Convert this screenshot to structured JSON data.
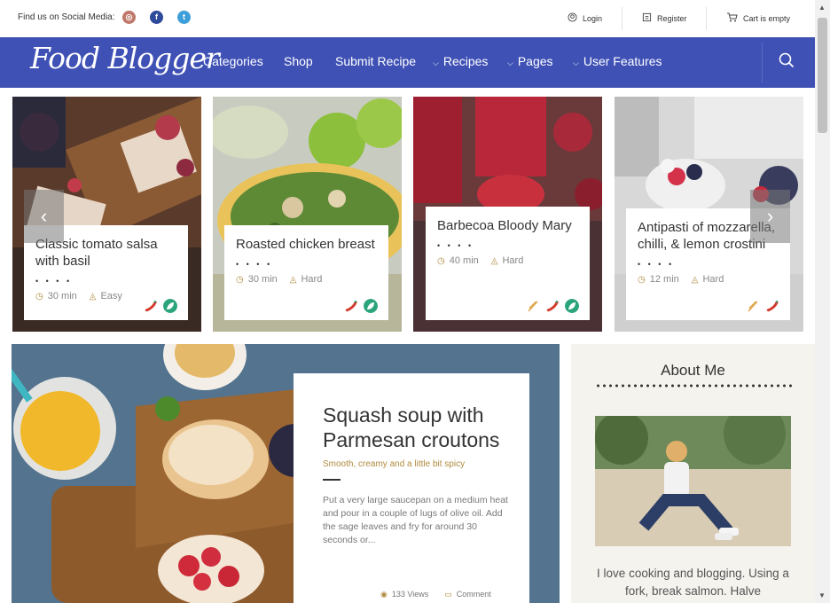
{
  "topbar": {
    "social_label": "Find us on Social Media:",
    "social_icons": [
      "instagram-icon",
      "facebook-icon",
      "twitter-icon"
    ],
    "login": "Login",
    "register": "Register",
    "cart": "Cart is empty"
  },
  "nav": {
    "logo": "Food Blogger",
    "items": [
      {
        "label": "Categories",
        "dropdown": false
      },
      {
        "label": "Shop",
        "dropdown": false
      },
      {
        "label": "Submit Recipe",
        "dropdown": false
      },
      {
        "label": "Recipes",
        "dropdown": true
      },
      {
        "label": "Pages",
        "dropdown": true
      },
      {
        "label": "User Features",
        "dropdown": true
      }
    ],
    "accent": "#3f51b5"
  },
  "slider": {
    "cards": [
      {
        "title": "Classic tomato salsa with basil",
        "dots": "• • • •",
        "time": "30 min",
        "difficulty": "Easy"
      },
      {
        "title": "Roasted chicken breast",
        "dots": "• • • •",
        "time": "30 min",
        "difficulty": "Hard"
      },
      {
        "title": "Barbecoa Bloody Mary",
        "dots": "• • • •",
        "time": "40 min",
        "difficulty": "Hard"
      },
      {
        "title": "Antipasti of mozzarella, chilli, & lemon crostini",
        "dots": "• • • •",
        "time": "12 min",
        "difficulty": "Hard"
      }
    ]
  },
  "featured": {
    "title": "Squash soup with Parmesan croutons",
    "subtitle": "Smooth, creamy and a little bit spicy",
    "excerpt": "Put a very large saucepan on a medium heat and pour in a couple of lugs of olive oil. Add the sage leaves and fry for around 30 seconds or...",
    "views": "133 Views",
    "comment": "Comment"
  },
  "about": {
    "title": "About Me",
    "text": "I love cooking and blogging. Using a fork, break salmon. Halve"
  },
  "colors": {
    "gold": "#b08a3e",
    "chili": "#d43a2b",
    "leaf": "#2aa47a",
    "wheat": "#e0a951"
  }
}
